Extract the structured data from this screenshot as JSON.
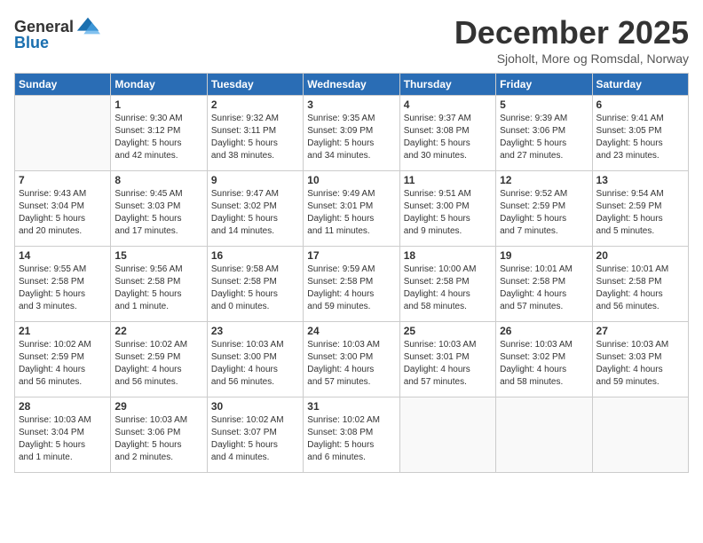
{
  "header": {
    "logo_general": "General",
    "logo_blue": "Blue",
    "title": "December 2025",
    "location": "Sjoholt, More og Romsdal, Norway"
  },
  "weekdays": [
    "Sunday",
    "Monday",
    "Tuesday",
    "Wednesday",
    "Thursday",
    "Friday",
    "Saturday"
  ],
  "weeks": [
    [
      {
        "day": "",
        "info": ""
      },
      {
        "day": "1",
        "info": "Sunrise: 9:30 AM\nSunset: 3:12 PM\nDaylight: 5 hours\nand 42 minutes."
      },
      {
        "day": "2",
        "info": "Sunrise: 9:32 AM\nSunset: 3:11 PM\nDaylight: 5 hours\nand 38 minutes."
      },
      {
        "day": "3",
        "info": "Sunrise: 9:35 AM\nSunset: 3:09 PM\nDaylight: 5 hours\nand 34 minutes."
      },
      {
        "day": "4",
        "info": "Sunrise: 9:37 AM\nSunset: 3:08 PM\nDaylight: 5 hours\nand 30 minutes."
      },
      {
        "day": "5",
        "info": "Sunrise: 9:39 AM\nSunset: 3:06 PM\nDaylight: 5 hours\nand 27 minutes."
      },
      {
        "day": "6",
        "info": "Sunrise: 9:41 AM\nSunset: 3:05 PM\nDaylight: 5 hours\nand 23 minutes."
      }
    ],
    [
      {
        "day": "7",
        "info": "Sunrise: 9:43 AM\nSunset: 3:04 PM\nDaylight: 5 hours\nand 20 minutes."
      },
      {
        "day": "8",
        "info": "Sunrise: 9:45 AM\nSunset: 3:03 PM\nDaylight: 5 hours\nand 17 minutes."
      },
      {
        "day": "9",
        "info": "Sunrise: 9:47 AM\nSunset: 3:02 PM\nDaylight: 5 hours\nand 14 minutes."
      },
      {
        "day": "10",
        "info": "Sunrise: 9:49 AM\nSunset: 3:01 PM\nDaylight: 5 hours\nand 11 minutes."
      },
      {
        "day": "11",
        "info": "Sunrise: 9:51 AM\nSunset: 3:00 PM\nDaylight: 5 hours\nand 9 minutes."
      },
      {
        "day": "12",
        "info": "Sunrise: 9:52 AM\nSunset: 2:59 PM\nDaylight: 5 hours\nand 7 minutes."
      },
      {
        "day": "13",
        "info": "Sunrise: 9:54 AM\nSunset: 2:59 PM\nDaylight: 5 hours\nand 5 minutes."
      }
    ],
    [
      {
        "day": "14",
        "info": "Sunrise: 9:55 AM\nSunset: 2:58 PM\nDaylight: 5 hours\nand 3 minutes."
      },
      {
        "day": "15",
        "info": "Sunrise: 9:56 AM\nSunset: 2:58 PM\nDaylight: 5 hours\nand 1 minute."
      },
      {
        "day": "16",
        "info": "Sunrise: 9:58 AM\nSunset: 2:58 PM\nDaylight: 5 hours\nand 0 minutes."
      },
      {
        "day": "17",
        "info": "Sunrise: 9:59 AM\nSunset: 2:58 PM\nDaylight: 4 hours\nand 59 minutes."
      },
      {
        "day": "18",
        "info": "Sunrise: 10:00 AM\nSunset: 2:58 PM\nDaylight: 4 hours\nand 58 minutes."
      },
      {
        "day": "19",
        "info": "Sunrise: 10:01 AM\nSunset: 2:58 PM\nDaylight: 4 hours\nand 57 minutes."
      },
      {
        "day": "20",
        "info": "Sunrise: 10:01 AM\nSunset: 2:58 PM\nDaylight: 4 hours\nand 56 minutes."
      }
    ],
    [
      {
        "day": "21",
        "info": "Sunrise: 10:02 AM\nSunset: 2:59 PM\nDaylight: 4 hours\nand 56 minutes."
      },
      {
        "day": "22",
        "info": "Sunrise: 10:02 AM\nSunset: 2:59 PM\nDaylight: 4 hours\nand 56 minutes."
      },
      {
        "day": "23",
        "info": "Sunrise: 10:03 AM\nSunset: 3:00 PM\nDaylight: 4 hours\nand 56 minutes."
      },
      {
        "day": "24",
        "info": "Sunrise: 10:03 AM\nSunset: 3:00 PM\nDaylight: 4 hours\nand 57 minutes."
      },
      {
        "day": "25",
        "info": "Sunrise: 10:03 AM\nSunset: 3:01 PM\nDaylight: 4 hours\nand 57 minutes."
      },
      {
        "day": "26",
        "info": "Sunrise: 10:03 AM\nSunset: 3:02 PM\nDaylight: 4 hours\nand 58 minutes."
      },
      {
        "day": "27",
        "info": "Sunrise: 10:03 AM\nSunset: 3:03 PM\nDaylight: 4 hours\nand 59 minutes."
      }
    ],
    [
      {
        "day": "28",
        "info": "Sunrise: 10:03 AM\nSunset: 3:04 PM\nDaylight: 5 hours\nand 1 minute."
      },
      {
        "day": "29",
        "info": "Sunrise: 10:03 AM\nSunset: 3:06 PM\nDaylight: 5 hours\nand 2 minutes."
      },
      {
        "day": "30",
        "info": "Sunrise: 10:02 AM\nSunset: 3:07 PM\nDaylight: 5 hours\nand 4 minutes."
      },
      {
        "day": "31",
        "info": "Sunrise: 10:02 AM\nSunset: 3:08 PM\nDaylight: 5 hours\nand 6 minutes."
      },
      {
        "day": "",
        "info": ""
      },
      {
        "day": "",
        "info": ""
      },
      {
        "day": "",
        "info": ""
      }
    ]
  ]
}
